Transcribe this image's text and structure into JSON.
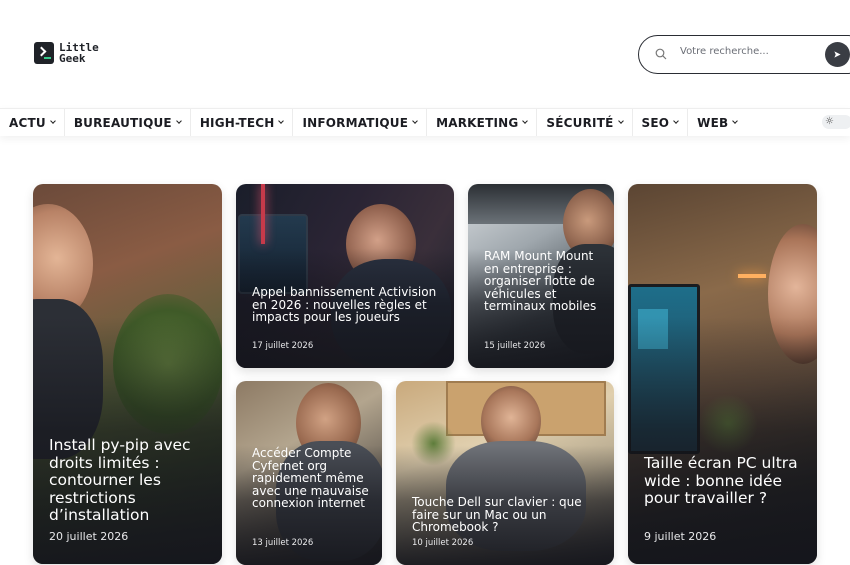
{
  "brand": {
    "line1": "Little",
    "line2": "Geek"
  },
  "search": {
    "placeholder": "Votre recherche...",
    "submit_icon": "arrow-right-icon"
  },
  "nav": {
    "items": [
      {
        "label": "ACTU"
      },
      {
        "label": "BUREAUTIQUE"
      },
      {
        "label": "HIGH-TECH"
      },
      {
        "label": "INFORMATIQUE"
      },
      {
        "label": "MARKETING"
      },
      {
        "label": "SÉCURITÉ"
      },
      {
        "label": "SEO"
      },
      {
        "label": "WEB"
      }
    ],
    "theme_icon": "sun-icon"
  },
  "articles": [
    {
      "title": "Install py-pip avec droits limités : contourner les restrictions d’installation",
      "date": "20 juillet 2026"
    },
    {
      "title": "Appel bannissement Activision en 2026 : nouvelles règles et impacts pour les joueurs",
      "date": "17 juillet 2026"
    },
    {
      "title": "RAM Mount Mount en entreprise : organiser flotte de véhicules et terminaux mobiles",
      "date": "15 juillet 2026"
    },
    {
      "title": "Taille écran PC ultra wide : bonne idée pour travailler ?",
      "date": "9 juillet 2026"
    },
    {
      "title": "Accéder Compte Cyfernet org rapidement même avec une mauvaise connexion internet",
      "date": "13 juillet 2026"
    },
    {
      "title": "Touche Dell sur clavier : que faire sur un Mac ou un Chromebook ?",
      "date": "10 juillet 2026"
    }
  ]
}
